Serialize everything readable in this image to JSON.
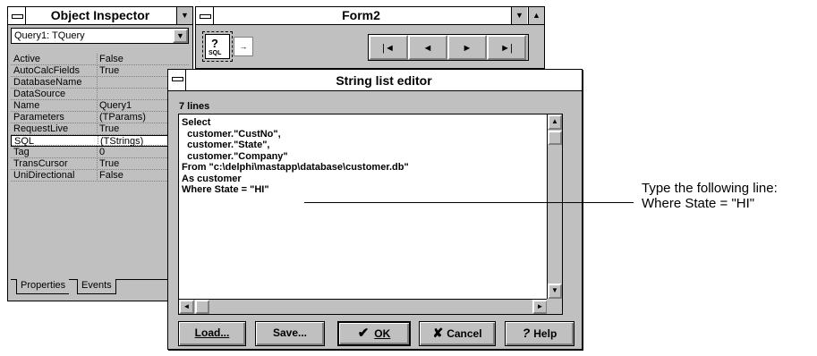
{
  "object_inspector": {
    "title": "Object Inspector",
    "selector_value": "Query1: TQuery",
    "properties": [
      {
        "name": "Active",
        "value": "False"
      },
      {
        "name": "AutoCalcFields",
        "value": "True"
      },
      {
        "name": "DatabaseName",
        "value": ""
      },
      {
        "name": "DataSource",
        "value": ""
      },
      {
        "name": "Name",
        "value": "Query1"
      },
      {
        "name": "Parameters",
        "value": "(TParams)"
      },
      {
        "name": "RequestLive",
        "value": "True"
      },
      {
        "name": "SQL",
        "value": "(TStrings)"
      },
      {
        "name": "Tag",
        "value": "0"
      },
      {
        "name": "TransCursor",
        "value": "True"
      },
      {
        "name": "UniDirectional",
        "value": "False"
      }
    ],
    "tabs": [
      "Properties",
      "Events"
    ]
  },
  "form2": {
    "title": "Form2",
    "component_label": "SQL",
    "nav_buttons": [
      "|◄",
      "◄",
      "►",
      "►|"
    ]
  },
  "string_list_editor": {
    "title": "String list editor",
    "line_count": "7 lines",
    "lines": [
      "Select",
      "  customer.\"CustNo\",",
      "  customer.\"State\",",
      "  customer.\"Company\"",
      "From \"c:\\delphi\\mastapp\\database\\customer.db\"",
      "As customer",
      "Where State = \"HI\""
    ],
    "buttons": {
      "load": "Load...",
      "save": "Save...",
      "ok": "OK",
      "cancel": "Cancel",
      "help": "Help"
    }
  },
  "callout": {
    "line1": "Type the following line:",
    "line2": "Where State = \"HI\""
  }
}
